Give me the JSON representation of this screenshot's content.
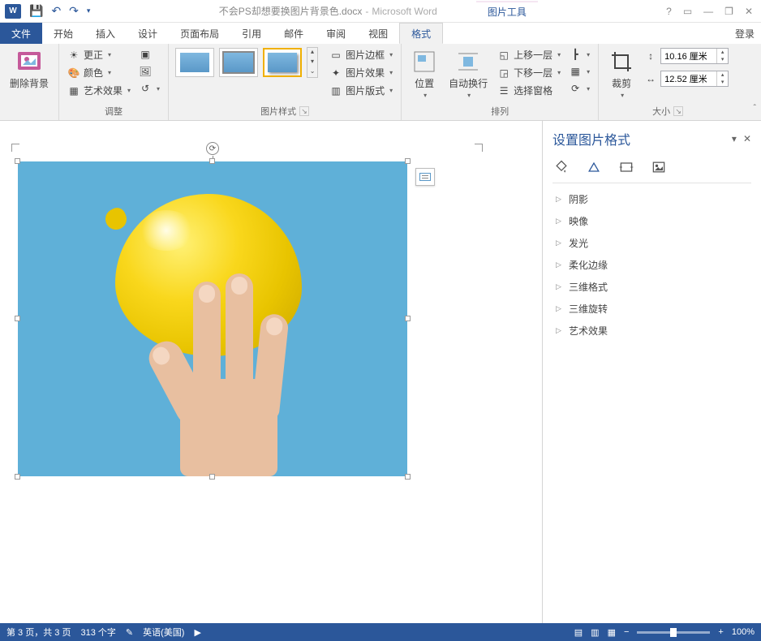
{
  "title": {
    "doc": "不会PS却想要换图片背景色.docx",
    "app": "Microsoft Word",
    "sep": " - ",
    "contextTab": "图片工具",
    "help": "?"
  },
  "qat": {
    "save": "💾",
    "undo": "↶",
    "redo": "↷",
    "more": "▾"
  },
  "win": {
    "min": "—",
    "restore": "❐",
    "ribbonOpt": "▭",
    "close": "✕"
  },
  "tabs": {
    "file": "文件",
    "home": "开始",
    "insert": "插入",
    "design": "设计",
    "layout": "页面布局",
    "ref": "引用",
    "mail": "邮件",
    "review": "审阅",
    "view": "视图",
    "format": "格式",
    "login": "登录"
  },
  "ribbon": {
    "removeBg": "删除背景",
    "adjust": {
      "correct": "更正",
      "color": "颜色",
      "artistic": "艺术效果",
      "label": "调整"
    },
    "styles": {
      "border": "图片边框",
      "effects": "图片效果",
      "layout": "图片版式",
      "label": "图片样式"
    },
    "arrange": {
      "position": "位置",
      "wrap": "自动换行",
      "forward": "上移一层",
      "backward": "下移一层",
      "selpane": "选择窗格",
      "label": "排列"
    },
    "size": {
      "crop": "裁剪",
      "height": "10.16 厘米",
      "width": "12.52 厘米",
      "label": "大小"
    }
  },
  "pane": {
    "title": "设置图片格式",
    "items": [
      "阴影",
      "映像",
      "发光",
      "柔化边缘",
      "三维格式",
      "三维旋转",
      "艺术效果"
    ]
  },
  "status": {
    "page": "第 3 页，共 3 页",
    "words": "313 个字",
    "lang": "英语(美国)",
    "zoom": "100%",
    "minus": "−",
    "plus": "+"
  }
}
